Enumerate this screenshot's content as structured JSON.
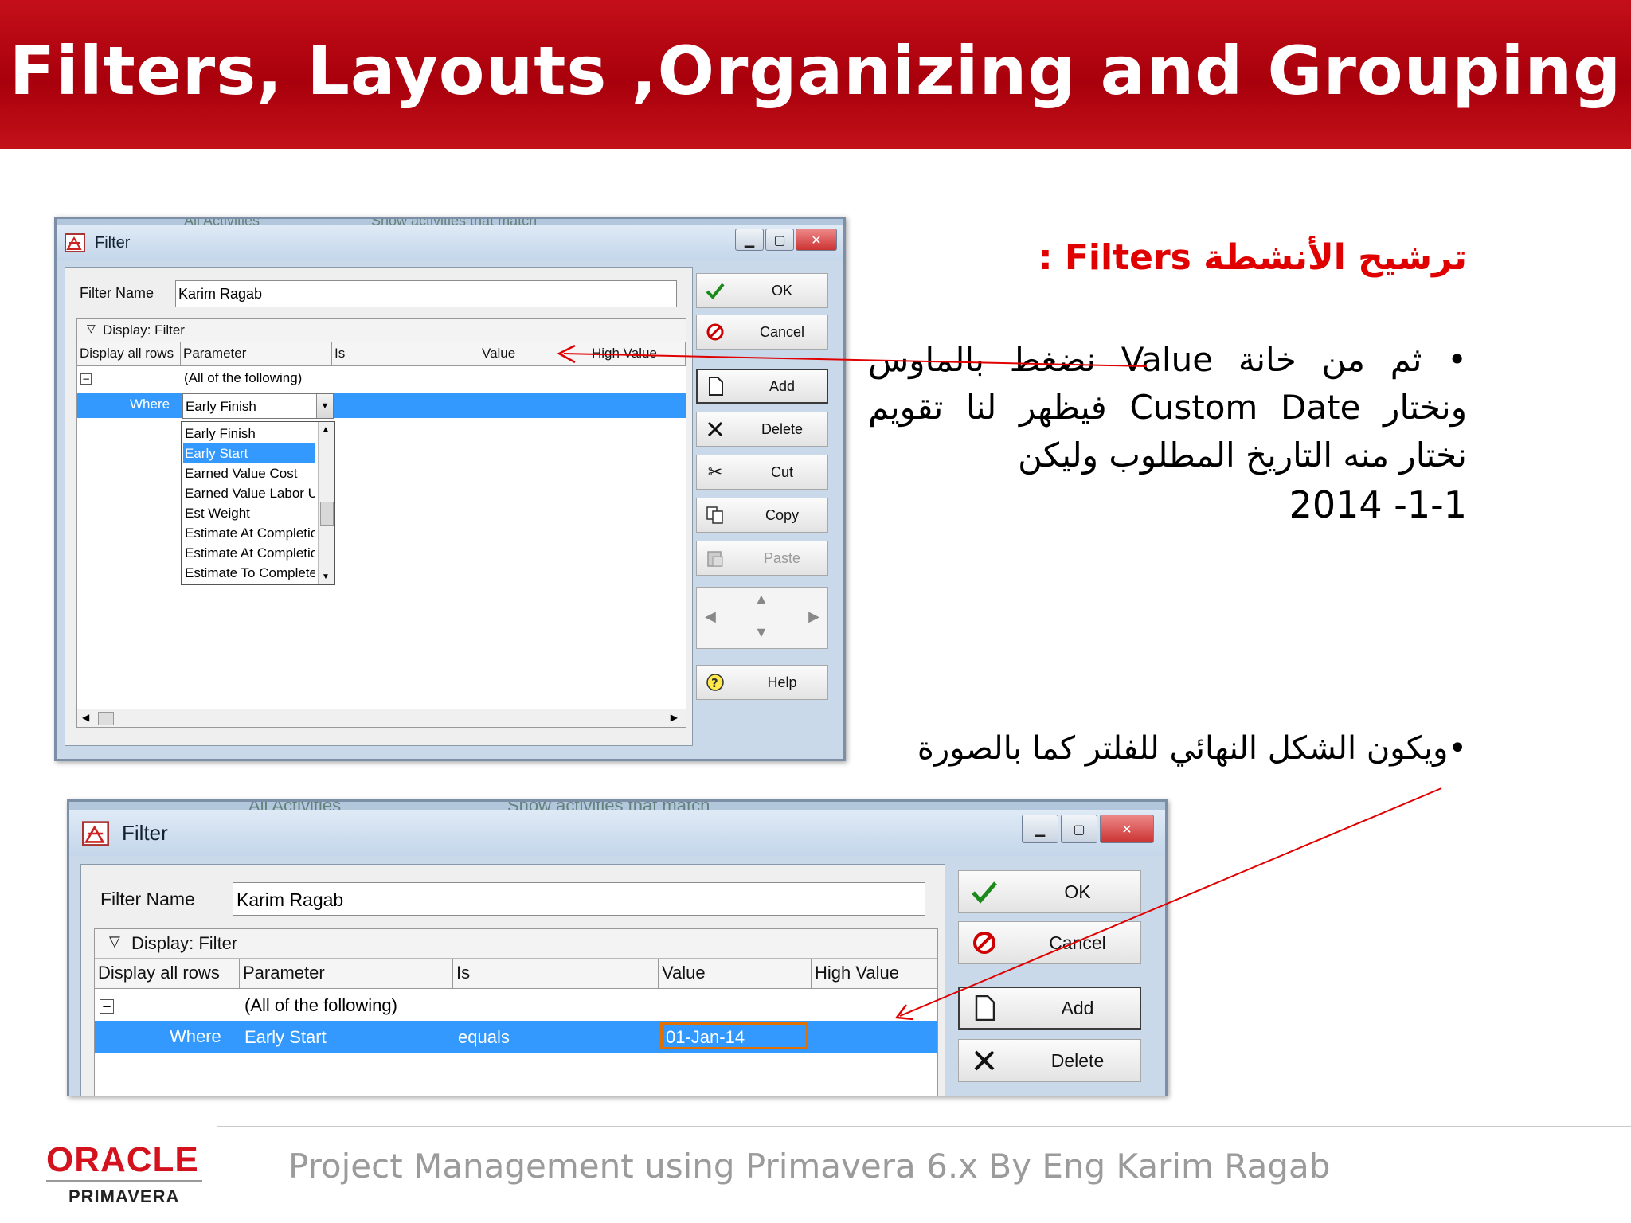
{
  "slide": {
    "title": "Filters, Layouts ,Organizing and Grouping",
    "heading_ar": "ترشيح الأنشطة Filters :",
    "bullet1_line1": "• ثم من خانة Value نضغط بالماوس",
    "bullet1_line2": "ونختار Custom Date فيظهر لنا تقويم",
    "bullet1_line3": "نختار منه التاريخ المطلوب وليكن",
    "bullet1_line4": "2014 -1-1",
    "bullet2": "•ويكون الشكل النهائي للفلتر كما بالصورة",
    "footer_text": "Project Management using Primavera 6.x By Eng Karim Ragab",
    "logo_oracle": "ORACLE",
    "logo_primavera": "PRIMAVERA"
  },
  "colors": {
    "header_red": "#b8000f",
    "heading_red": "#e00000",
    "selection_blue": "#3399ff",
    "annotation_red": "#e00000"
  },
  "dialog1": {
    "window_title": "Filter",
    "filter_name_label": "Filter Name",
    "filter_name_value": "Karim Ragab",
    "display_caption": "Display: Filter",
    "columns": [
      "Display all rows",
      "Parameter",
      "Is",
      "Value",
      "High Value"
    ],
    "all_of_following": "(All of the following)",
    "where_label": "Where",
    "parameter_selected": "Early Finish",
    "dropdown_options": [
      "Early Finish",
      "Early Start",
      "Earned Value Cost",
      "Earned Value Labor U",
      "Est Weight",
      "Estimate At Completion",
      "Estimate At Completion",
      "Estimate To Complete"
    ],
    "dropdown_highlighted": "Early Start",
    "buttons": {
      "ok": "OK",
      "cancel": "Cancel",
      "add": "Add",
      "delete": "Delete",
      "cut": "Cut",
      "copy": "Copy",
      "paste": "Paste",
      "help": "Help"
    },
    "back_text_left": "All Activities",
    "back_text_mid": "Show activities that match"
  },
  "dialog2": {
    "window_title": "Filter",
    "filter_name_label": "Filter Name",
    "filter_name_value": "Karim Ragab",
    "display_caption": "Display: Filter",
    "columns": [
      "Display all rows",
      "Parameter",
      "Is",
      "Value",
      "High Value"
    ],
    "all_of_following": "(All of the following)",
    "row": {
      "where": "Where",
      "parameter": "Early Start",
      "is": "equals",
      "value": "01-Jan-14"
    },
    "buttons": {
      "ok": "OK",
      "cancel": "Cancel",
      "add": "Add",
      "delete": "Delete"
    },
    "back_text_left": "All Activities",
    "back_text_mid": "Show activities that match"
  }
}
